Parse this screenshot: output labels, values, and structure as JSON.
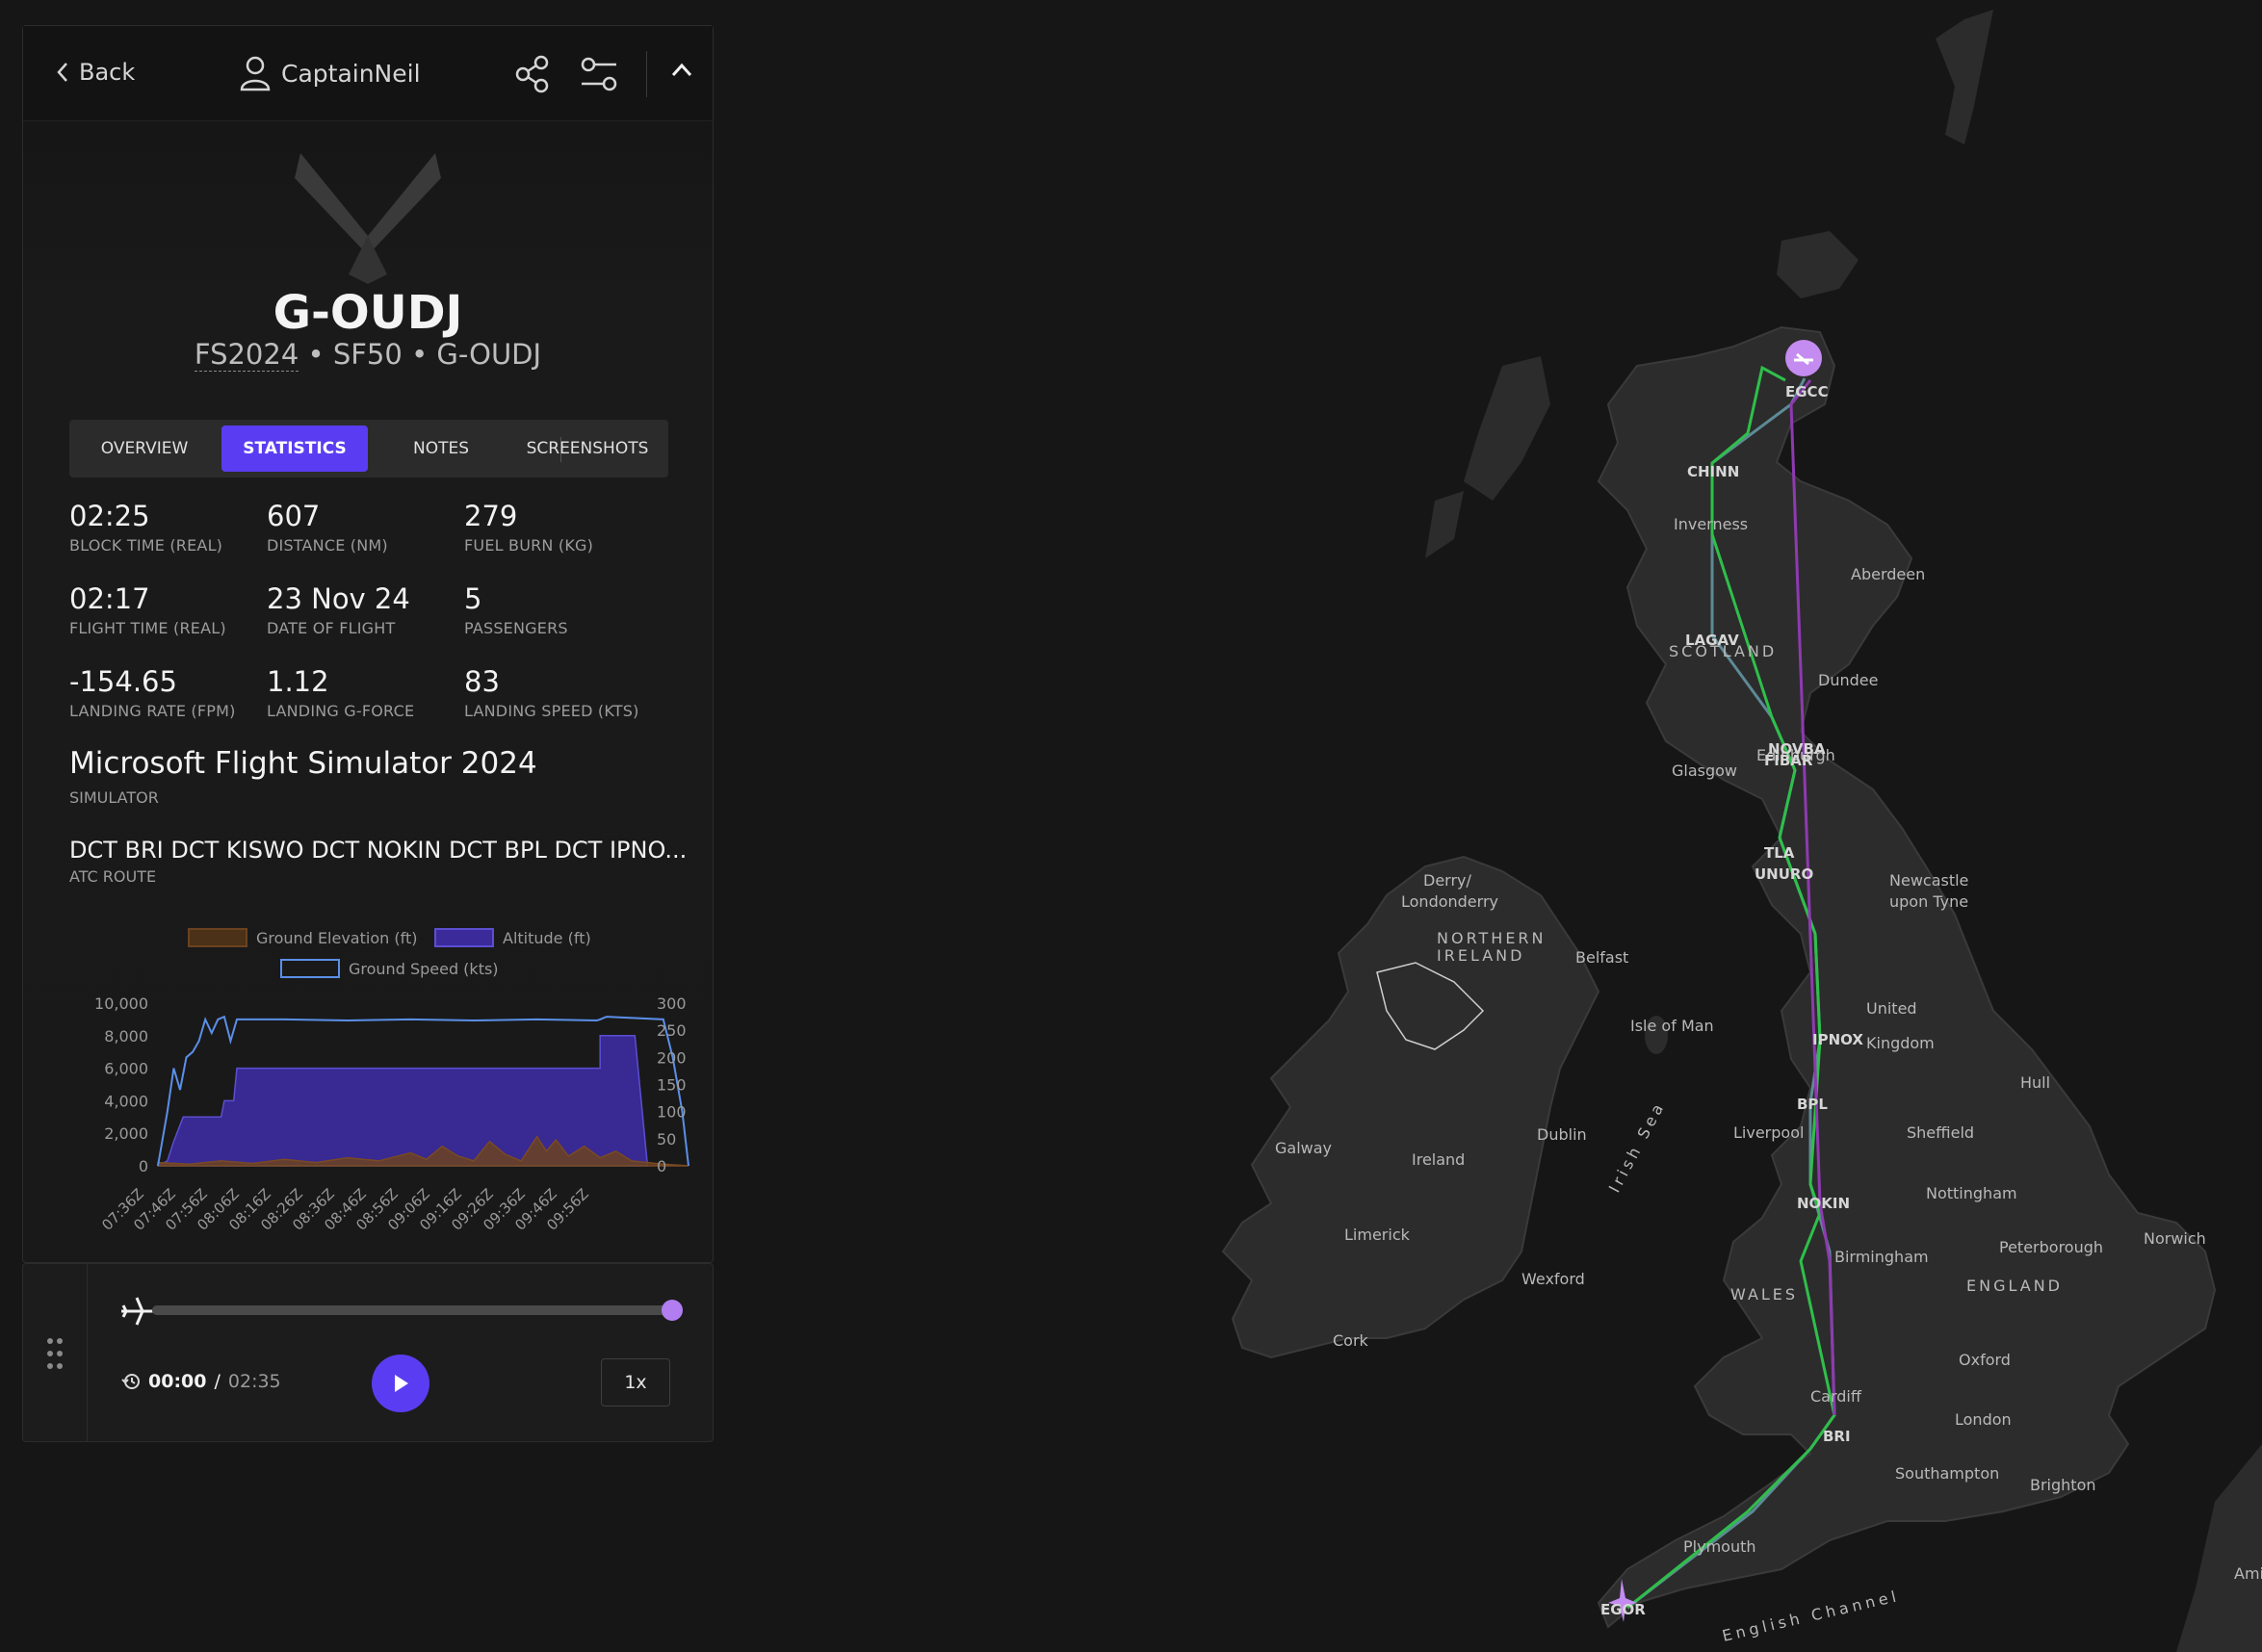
{
  "header": {
    "back_label": "Back",
    "username": "CaptainNeil"
  },
  "aircraft": {
    "registration": "G-OUDJ",
    "sim_code": "FS2024",
    "type_code": "SF50",
    "registration_sub": "G-OUDJ",
    "separator": "•"
  },
  "tabs": [
    {
      "label": "OVERVIEW",
      "active": false
    },
    {
      "label": "STATISTICS",
      "active": true
    },
    {
      "label": "NOTES",
      "active": false
    },
    {
      "label": "SCREENSHOTS",
      "active": false
    }
  ],
  "stats": [
    {
      "value": "02:25",
      "label": "BLOCK TIME (REAL)"
    },
    {
      "value": "607",
      "label": "DISTANCE (NM)"
    },
    {
      "value": "279",
      "label": "FUEL BURN (KG)"
    },
    {
      "value": "02:17",
      "label": "FLIGHT TIME (REAL)"
    },
    {
      "value": "23 Nov 24",
      "label": "DATE OF FLIGHT"
    },
    {
      "value": "5",
      "label": "PASSENGERS"
    },
    {
      "value": "-154.65",
      "label": "LANDING RATE (FPM)"
    },
    {
      "value": "1.12",
      "label": "LANDING G-FORCE"
    },
    {
      "value": "83",
      "label": "LANDING SPEED (KTS)"
    }
  ],
  "simulator": {
    "name": "Microsoft Flight Simulator 2024",
    "label": "SIMULATOR"
  },
  "route": {
    "text": "DCT BRI DCT KISWO DCT NOKIN DCT BPL DCT IPNO...",
    "label": "ATC ROUTE"
  },
  "chart_data": {
    "type": "area",
    "legend": [
      "Ground Elevation (ft)",
      "Altitude (ft)",
      "Ground Speed (kts)"
    ],
    "x": [
      "07:36Z",
      "07:46Z",
      "07:56Z",
      "08:06Z",
      "08:16Z",
      "08:26Z",
      "08:36Z",
      "08:46Z",
      "08:56Z",
      "09:06Z",
      "09:16Z",
      "09:26Z",
      "09:36Z",
      "09:46Z",
      "09:56Z"
    ],
    "y_left_ticks": [
      "10,000",
      "8,000",
      "6,000",
      "4,000",
      "2,000",
      "0"
    ],
    "y_right_ticks": [
      "300",
      "250",
      "200",
      "150",
      "100",
      "50",
      "0"
    ],
    "y_left_range": [
      0,
      10000
    ],
    "y_right_range": [
      0,
      300
    ],
    "x_minutes_range": [
      0,
      150
    ],
    "series": [
      {
        "name": "Altitude (ft)",
        "color": "#3a2a9a",
        "points": [
          [
            0,
            0
          ],
          [
            3,
            300
          ],
          [
            5,
            1500
          ],
          [
            8,
            3000
          ],
          [
            20,
            3000
          ],
          [
            21,
            4000
          ],
          [
            24,
            4000
          ],
          [
            25,
            6000
          ],
          [
            140,
            6000
          ],
          [
            140,
            8000
          ],
          [
            151,
            8000
          ],
          [
            155,
            0
          ]
        ]
      },
      {
        "name": "Ground Speed (kts)",
        "color": "#5b8fe8",
        "points": [
          [
            0,
            0
          ],
          [
            3,
            100
          ],
          [
            5,
            180
          ],
          [
            7,
            140
          ],
          [
            9,
            200
          ],
          [
            11,
            210
          ],
          [
            13,
            230
          ],
          [
            15,
            270
          ],
          [
            17,
            245
          ],
          [
            19,
            270
          ],
          [
            21,
            275
          ],
          [
            23,
            230
          ],
          [
            25,
            270
          ],
          [
            40,
            270
          ],
          [
            60,
            268
          ],
          [
            80,
            270
          ],
          [
            100,
            268
          ],
          [
            120,
            270
          ],
          [
            139,
            268
          ],
          [
            140,
            270
          ],
          [
            142,
            275
          ],
          [
            160,
            270
          ],
          [
            163,
            200
          ],
          [
            166,
            100
          ],
          [
            168,
            0
          ]
        ]
      },
      {
        "name": "Ground Elevation (ft)",
        "color": "#6b4220",
        "points": [
          [
            0,
            200
          ],
          [
            10,
            100
          ],
          [
            20,
            300
          ],
          [
            30,
            150
          ],
          [
            40,
            400
          ],
          [
            50,
            200
          ],
          [
            60,
            500
          ],
          [
            70,
            300
          ],
          [
            80,
            800
          ],
          [
            85,
            400
          ],
          [
            90,
            1200
          ],
          [
            95,
            600
          ],
          [
            100,
            300
          ],
          [
            105,
            1500
          ],
          [
            110,
            700
          ],
          [
            115,
            300
          ],
          [
            120,
            1800
          ],
          [
            123,
            900
          ],
          [
            126,
            1600
          ],
          [
            130,
            600
          ],
          [
            135,
            1200
          ],
          [
            140,
            500
          ],
          [
            145,
            900
          ],
          [
            150,
            300
          ],
          [
            155,
            200
          ],
          [
            160,
            100
          ],
          [
            168,
            0
          ]
        ]
      }
    ]
  },
  "player": {
    "current_time": "00:00",
    "separator": "/",
    "total_time": "02:35",
    "speed_label": "1x",
    "progress": 0.99
  },
  "map": {
    "labels": [
      {
        "text": "United",
        "big": true
      },
      {
        "text": "Kingdom",
        "big": true
      },
      {
        "text": "Ireland",
        "big": true
      },
      {
        "text": "Inverness"
      },
      {
        "text": "Aberdeen"
      },
      {
        "text": "SCOTLAND",
        "caps": true
      },
      {
        "text": "Dundee"
      },
      {
        "text": "Edinburgh"
      },
      {
        "text": "Glasgow"
      },
      {
        "text": "Newcastle"
      },
      {
        "text": "upon Tyne"
      },
      {
        "text": "Derry/"
      },
      {
        "text": "Londonderry"
      },
      {
        "text": "NORTHERN",
        "caps": true
      },
      {
        "text": "IRELAND",
        "caps": true
      },
      {
        "text": "Belfast"
      },
      {
        "text": "Isle of Man"
      },
      {
        "text": "Hull"
      },
      {
        "text": "Liverpool"
      },
      {
        "text": "Sheffield"
      },
      {
        "text": "Dublin"
      },
      {
        "text": "Galway"
      },
      {
        "text": "Nottingham"
      },
      {
        "text": "Limerick"
      },
      {
        "text": "Birmingham"
      },
      {
        "text": "Peterborough"
      },
      {
        "text": "Norwich"
      },
      {
        "text": "ENGLAND",
        "caps": true
      },
      {
        "text": "WALES",
        "caps": true
      },
      {
        "text": "Wexford"
      },
      {
        "text": "Cork"
      },
      {
        "text": "Oxford"
      },
      {
        "text": "Cardiff"
      },
      {
        "text": "London"
      },
      {
        "text": "Southampton"
      },
      {
        "text": "Brighton"
      },
      {
        "text": "Plymouth"
      },
      {
        "text": "Irish Sea"
      },
      {
        "text": "English Channel"
      },
      {
        "text": "Ami"
      }
    ],
    "waypoints": [
      "EGCC",
      "CHINN",
      "LAGAV",
      "NOVBA",
      "FIBAR",
      "TLA",
      "UNURO",
      "IPNOX",
      "BPL",
      "NOKIN",
      "BRI",
      "EGOR"
    ],
    "route_colors": {
      "planned": "#5d8a96",
      "flown": "#2fbf4a",
      "alt": "#8e3ab0"
    }
  }
}
